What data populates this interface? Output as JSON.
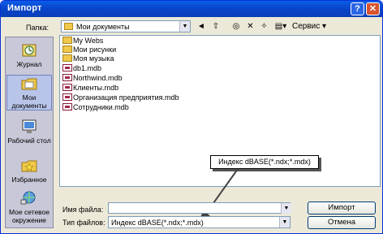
{
  "window": {
    "title": "Импорт",
    "help_label": "?",
    "close_label": "✕"
  },
  "toolbar": {
    "lookin_label": "Папка:",
    "lookin_value": "Мои документы",
    "back_icon": "◄",
    "up_icon": "⇧",
    "web_icon": "◎",
    "delete_icon": "✕",
    "newfolder_icon": "✧",
    "views_icon": "▤▾",
    "tools_label": "Сервис ▾"
  },
  "places": [
    {
      "label": "Журнал",
      "icon": "history-icon"
    },
    {
      "label": "Мои документы",
      "icon": "my-documents-icon"
    },
    {
      "label": "Рабочий стол",
      "icon": "desktop-icon"
    },
    {
      "label": "Избранное",
      "icon": "favorites-icon"
    },
    {
      "label": "Мое сетевое окружение",
      "icon": "network-icon"
    }
  ],
  "files": [
    {
      "name": "My Webs",
      "type": "folder"
    },
    {
      "name": "Мои рисунки",
      "type": "folder"
    },
    {
      "name": "Моя музыка",
      "type": "folder"
    },
    {
      "name": "db1.mdb",
      "type": "db"
    },
    {
      "name": "Northwind.mdb",
      "type": "db"
    },
    {
      "name": "Клиенты.mdb",
      "type": "db"
    },
    {
      "name": "Организация предприятия.mdb",
      "type": "db"
    },
    {
      "name": "Сотрудники.mdb",
      "type": "db"
    }
  ],
  "form": {
    "filename_label": "Имя файла:",
    "filename_value": "",
    "filetype_label": "Тип файлов:",
    "filetype_value": "Индекс dBASE(*.ndx;*.mdx)"
  },
  "buttons": {
    "open_label": "Импорт",
    "cancel_label": "Отмена"
  },
  "callout": {
    "text": "Индекс dBASE(*.ndx;*.mdx)"
  }
}
